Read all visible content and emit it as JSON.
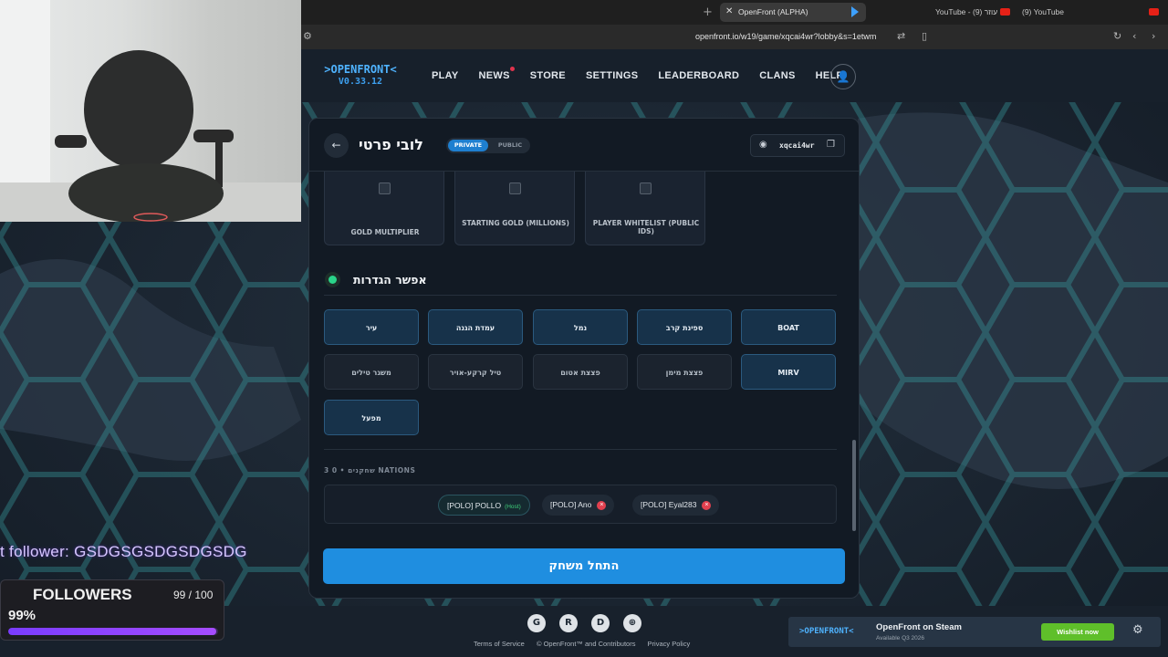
{
  "browser": {
    "active_tab": "OpenFront (ALPHA)",
    "tab2": "YouTube - עוזר (9)",
    "tab3": "(9) YouTube",
    "url": "openfront.io/w19/game/xqcai4wr?lobby&s=1etwm"
  },
  "nav": {
    "logo": ">OPENFRONT<",
    "version": "V0.33.12",
    "links": [
      "PLAY",
      "NEWS",
      "STORE",
      "SETTINGS",
      "LEADERBOARD",
      "CLANS",
      "HELP"
    ]
  },
  "lobby": {
    "title": "לובי פרטי",
    "private_label": "PRIVATE",
    "public_label": "PUBLIC",
    "code": "xqcai4wr",
    "options": [
      "GOLD MULTIPLIER",
      "STARTING GOLD (MILLIONS)",
      "PLAYER WHITELIST (PUBLIC IDS)"
    ],
    "section_title": "אפשר הגדרות",
    "units": [
      {
        "label": "BOAT",
        "enabled": true
      },
      {
        "label": "ספינת קרב",
        "enabled": true
      },
      {
        "label": "נמל",
        "enabled": true
      },
      {
        "label": "עמדת הגנה",
        "enabled": true
      },
      {
        "label": "עיר",
        "enabled": true
      },
      {
        "label": "MIRV",
        "enabled": true
      },
      {
        "label": "פצצת מימן",
        "enabled": false
      },
      {
        "label": "פצצת אטום",
        "enabled": false
      },
      {
        "label": "טיל קרקע-אויר",
        "enabled": false
      },
      {
        "label": "משגר טילים",
        "enabled": false
      },
      {
        "label": "מפעל",
        "enabled": true
      }
    ],
    "players_header": "3 שחקנים • 0 NATIONS",
    "players": [
      {
        "name": "[POLO] POLLO",
        "tag": "(Host)"
      },
      {
        "name": "[POLO] Ano"
      },
      {
        "name": "[POLO] Eyal283"
      }
    ],
    "start_button": "התחל משחק"
  },
  "stream": {
    "latest_follower": "t follower: GSDGSGSDGSDGSDG",
    "followers_title": "FOLLOWERS",
    "followers_count": "99 / 100",
    "followers_percent": "99%",
    "followers_progress": 0.99
  },
  "footer": {
    "terms": "Terms of Service",
    "copyright": "© OpenFront™ and Contributors",
    "privacy": "Privacy Policy",
    "steam_logo": ">OPENFRONT<",
    "steam_title": "OpenFront on Steam",
    "steam_sub": "Available Q3 2026",
    "wishlist": "Wishlist now"
  },
  "colors": {
    "accent": "#1f8ee0",
    "unit_on": "#17324a",
    "host_green": "#3ecf7a",
    "remove_red": "#e2404f",
    "follower_bar": "#8a3cff"
  }
}
